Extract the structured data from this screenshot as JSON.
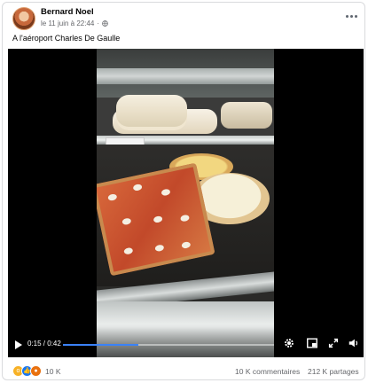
{
  "post": {
    "author": "Bernard Noel",
    "date": "le 11 juin à 22:44",
    "separator": "·",
    "caption": "A l'aéroport Charles De Gaulle"
  },
  "video": {
    "current_time": "0:15",
    "duration": "0:42",
    "time_display": "0:15 / 0:42",
    "progress": 0.357,
    "accent_color": "#3b82f6"
  },
  "stats": {
    "reactions_count": "10 K",
    "comments": "10 K commentaires",
    "shares": "212 K partages",
    "reaction_icons": [
      "wow",
      "like",
      "angry"
    ]
  },
  "icons": {
    "more": "more-icon",
    "globe": "globe-icon",
    "play": "play-icon",
    "settings": "gear-icon",
    "miniplayer": "miniplayer-icon",
    "fullscreen": "fullscreen-icon",
    "volume": "volume-icon"
  }
}
